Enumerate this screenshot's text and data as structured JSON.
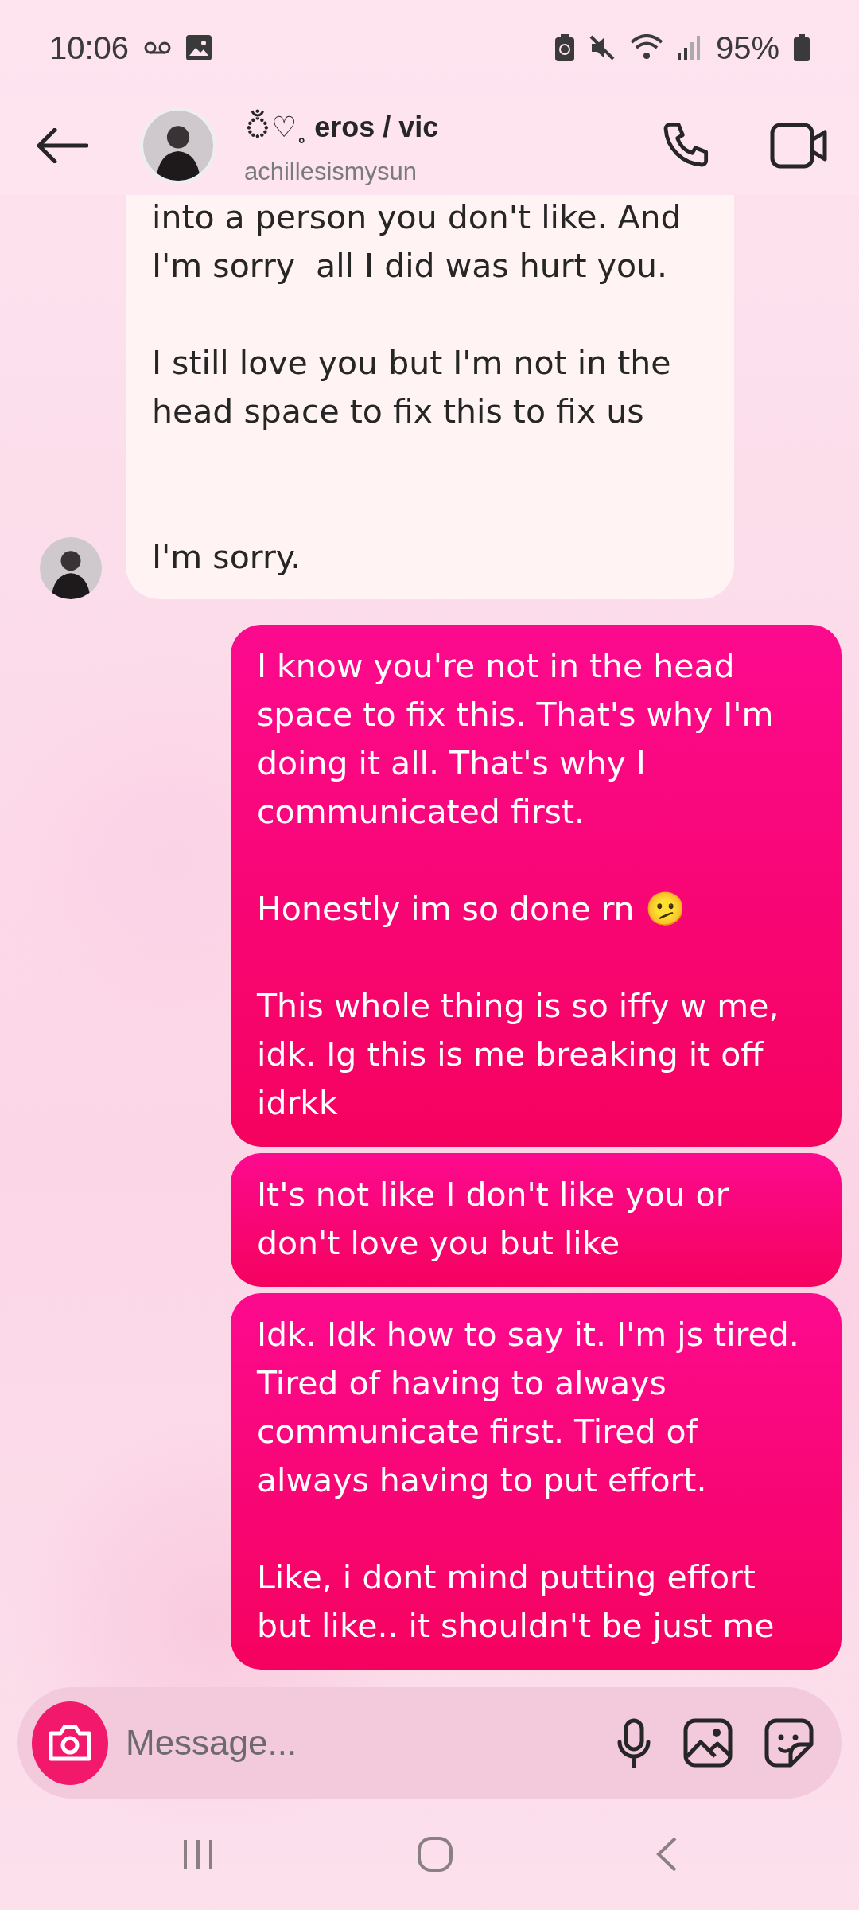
{
  "status_bar": {
    "time": "10:06",
    "battery": "95%"
  },
  "header": {
    "name": "ঁ♡˳ eros / vic",
    "username": "achillesismysun"
  },
  "messages": [
    {
      "kind": "received",
      "text": "into a person you don't like. And\nI'm sorry  all I did was hurt you.\n\nI still love you but I'm not in the head space to fix this to fix us\n\n\nI'm sorry."
    },
    {
      "kind": "sent",
      "text": "I know you're not in the head space to fix this. That's why I'm doing it all. That's why I communicated first.\n\nHonestly im so done rn 🫤\n\nThis whole thing is so iffy w me, idk. Ig this is me breaking it off idrkk"
    },
    {
      "kind": "sent",
      "text": "It's not like I don't like you or don't love you but like"
    },
    {
      "kind": "sent",
      "text": "Idk. Idk how to say it. I'm js tired. Tired of having to always communicate first. Tired of always having to put effort.\n\nLike, i dont mind putting effort but like.. it shouldn't be just me"
    }
  ],
  "composer": {
    "placeholder": "Message..."
  }
}
